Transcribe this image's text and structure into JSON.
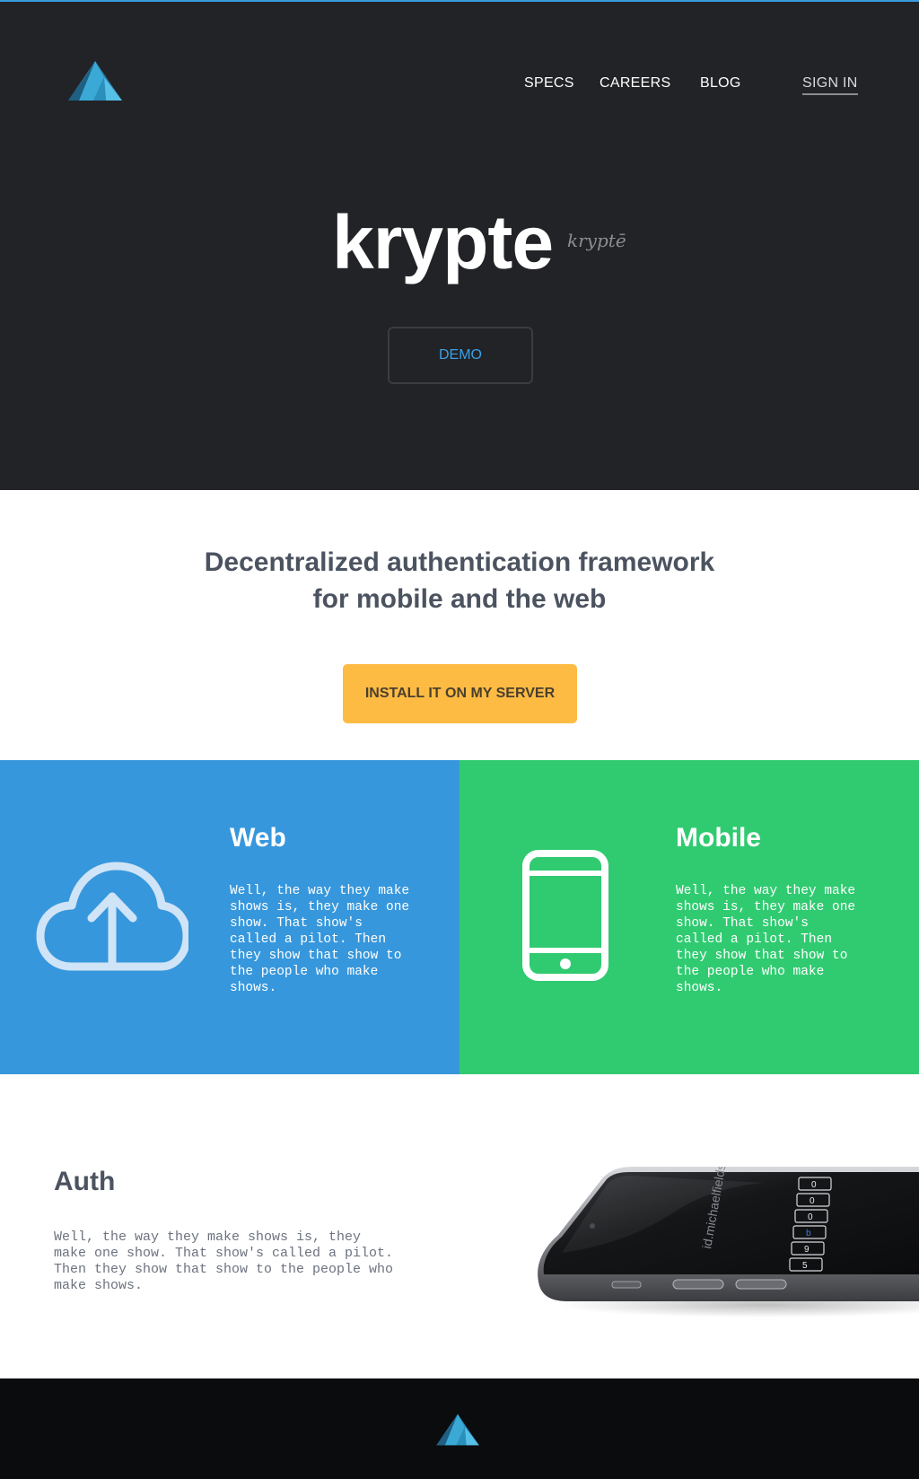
{
  "colors": {
    "hero_bg": "#222326",
    "accent_blue": "#3797dc",
    "accent_green": "#30cb71",
    "accent_yellow": "#fdbb43",
    "footer_bg": "#0b0c0e"
  },
  "header": {
    "logo_icon": "mountain-logo-icon",
    "nav": {
      "specs": "SPECS",
      "careers": "CAREERS",
      "blog": "BLOG",
      "sign_in": "SIGN IN"
    }
  },
  "hero": {
    "title": "krypte",
    "pronunciation": "kryptē",
    "demo_label": "DEMO"
  },
  "intro": {
    "tagline_line1": "Decentralized authentication framework",
    "tagline_line2": "for mobile and the web",
    "install_label": "INSTALL IT ON MY SERVER"
  },
  "features": {
    "web": {
      "icon": "cloud-upload-icon",
      "title": "Web",
      "text": "Well, the way they make shows is, they make one show. That show's called a pilot. Then they show that show to the people who make shows."
    },
    "mobile": {
      "icon": "smartphone-icon",
      "title": "Mobile",
      "text": "Well, the way they make shows is, they make one show. That show's called a pilot. Then they show that show to the people who make shows."
    }
  },
  "auth": {
    "title": "Auth",
    "text": "Well, the way they make shows is, they make one show. That show's called a pilot. Then they show that show to the people who make shows.",
    "device_image": "phone-device-image",
    "device_screen_text": "id.michaelfields.me",
    "device_keys": [
      "0",
      "0",
      "0",
      "b",
      "9",
      "5"
    ]
  },
  "footer": {
    "logo_icon": "mountain-logo-icon"
  }
}
